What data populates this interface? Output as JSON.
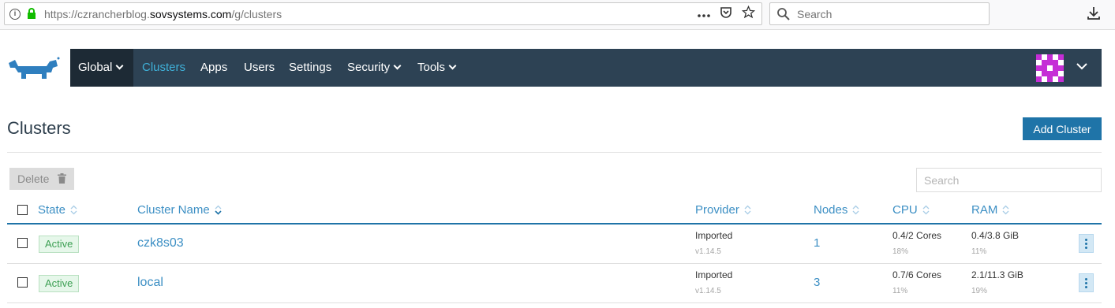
{
  "browser": {
    "url_prefix": "https://czrancherblog.",
    "url_host": "sovsystems.com",
    "url_path": "/g/clusters",
    "search_placeholder": "Search",
    "more_icon": "more-horizontal-icon",
    "pocket_icon": "pocket-icon",
    "star_icon": "bookmark-star-icon",
    "download_icon": "download-icon"
  },
  "nav": {
    "global_label": "Global",
    "items": [
      {
        "label": "Clusters",
        "active": true
      },
      {
        "label": "Apps"
      },
      {
        "label": "Users"
      },
      {
        "label": "Settings"
      },
      {
        "label": "Security",
        "dropdown": true
      },
      {
        "label": "Tools",
        "dropdown": true
      }
    ],
    "accent_color": "#3fb0d8",
    "bar_color": "#2d4254"
  },
  "page": {
    "title": "Clusters",
    "add_button": "Add Cluster",
    "delete_button": "Delete",
    "search_placeholder": "Search"
  },
  "table": {
    "columns": {
      "state": "State",
      "name": "Cluster Name",
      "provider": "Provider",
      "nodes": "Nodes",
      "cpu": "CPU",
      "ram": "RAM"
    },
    "rows": [
      {
        "state": "Active",
        "name": "czk8s03",
        "provider": "Imported",
        "version": "v1.14.5",
        "nodes": "1",
        "cpu": "0.4/2 Cores",
        "cpu_pct": "18%",
        "ram": "0.4/3.8 GiB",
        "ram_pct": "11%"
      },
      {
        "state": "Active",
        "name": "local",
        "provider": "Imported",
        "version": "v1.14.5",
        "nodes": "3",
        "cpu": "0.7/6 Cores",
        "cpu_pct": "11%",
        "ram": "2.1/11.3 GiB",
        "ram_pct": "19%"
      }
    ]
  }
}
